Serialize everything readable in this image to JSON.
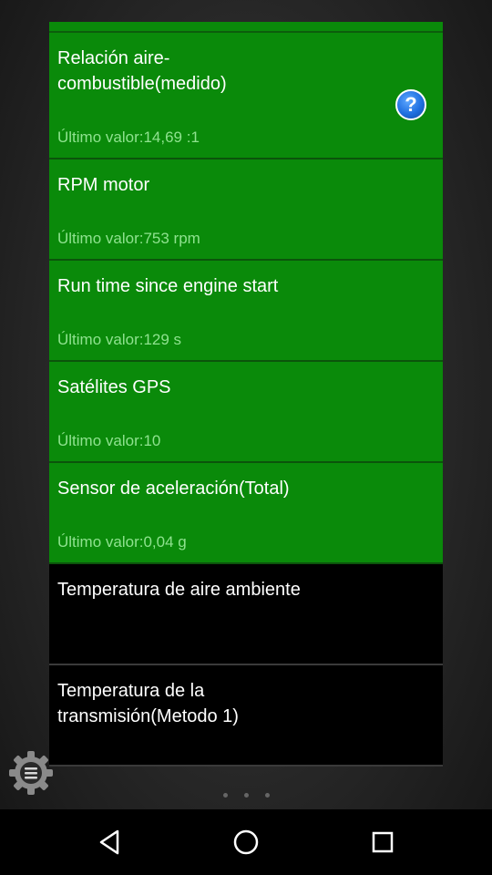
{
  "list": {
    "items": [
      {
        "title": "Relación aire-\ncombustible(medido)",
        "value": "Último valor:14,69 :1",
        "help_label": "?",
        "style": "green"
      },
      {
        "title": "RPM motor",
        "value": "Último valor:753 rpm",
        "style": "green"
      },
      {
        "title": "Run time since engine start",
        "value": "Último valor:129 s",
        "style": "green"
      },
      {
        "title": "Satélites GPS",
        "value": "Último valor:10",
        "style": "green"
      },
      {
        "title": "Sensor de aceleración(Total)",
        "value": "Último valor:0,04 g",
        "style": "green"
      },
      {
        "title": "Temperatura de aire ambiente",
        "value": "",
        "style": "black"
      },
      {
        "title": "Temperatura de la\ntransmisión(Metodo 1)",
        "value": "",
        "style": "black"
      }
    ]
  },
  "icons": {
    "help": "help-icon",
    "settings": "gear-icon",
    "back": "back-triangle-icon",
    "home": "home-circle-icon",
    "recents": "recents-square-icon"
  },
  "colors": {
    "selected_item_bg": "#0a8a0a",
    "value_text": "#8fe28f",
    "help_blue": "#1f6fe0"
  }
}
